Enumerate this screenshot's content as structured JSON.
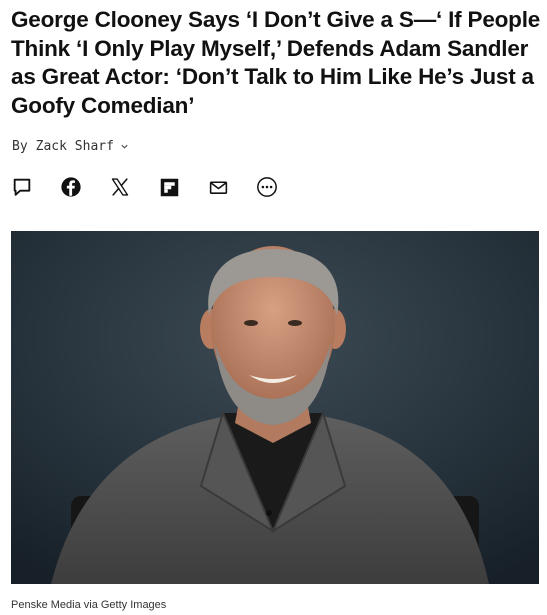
{
  "article": {
    "headline": "George Clooney Says ‘I Don’t Give a S—‘ If People Think ‘I Only Play Myself,’ Defends Adam Sandler as Great Actor: ‘Don’t Talk to Him Like He’s Just a Goofy Comedian’",
    "byline": {
      "prefix": "By",
      "author": "Zack Sharf",
      "icon": "chevron-down-icon"
    },
    "image_caption": "Penske Media via Getty Images"
  },
  "share": [
    {
      "name": "comment",
      "icon": "comment-icon"
    },
    {
      "name": "facebook",
      "icon": "facebook-icon"
    },
    {
      "name": "x",
      "icon": "x-icon"
    },
    {
      "name": "flipboard",
      "icon": "flipboard-icon"
    },
    {
      "name": "email",
      "icon": "email-icon"
    },
    {
      "name": "more",
      "icon": "more-icon"
    }
  ],
  "colors": {
    "text": "#111111",
    "byline": "#333333",
    "photo_background": "#202830"
  }
}
